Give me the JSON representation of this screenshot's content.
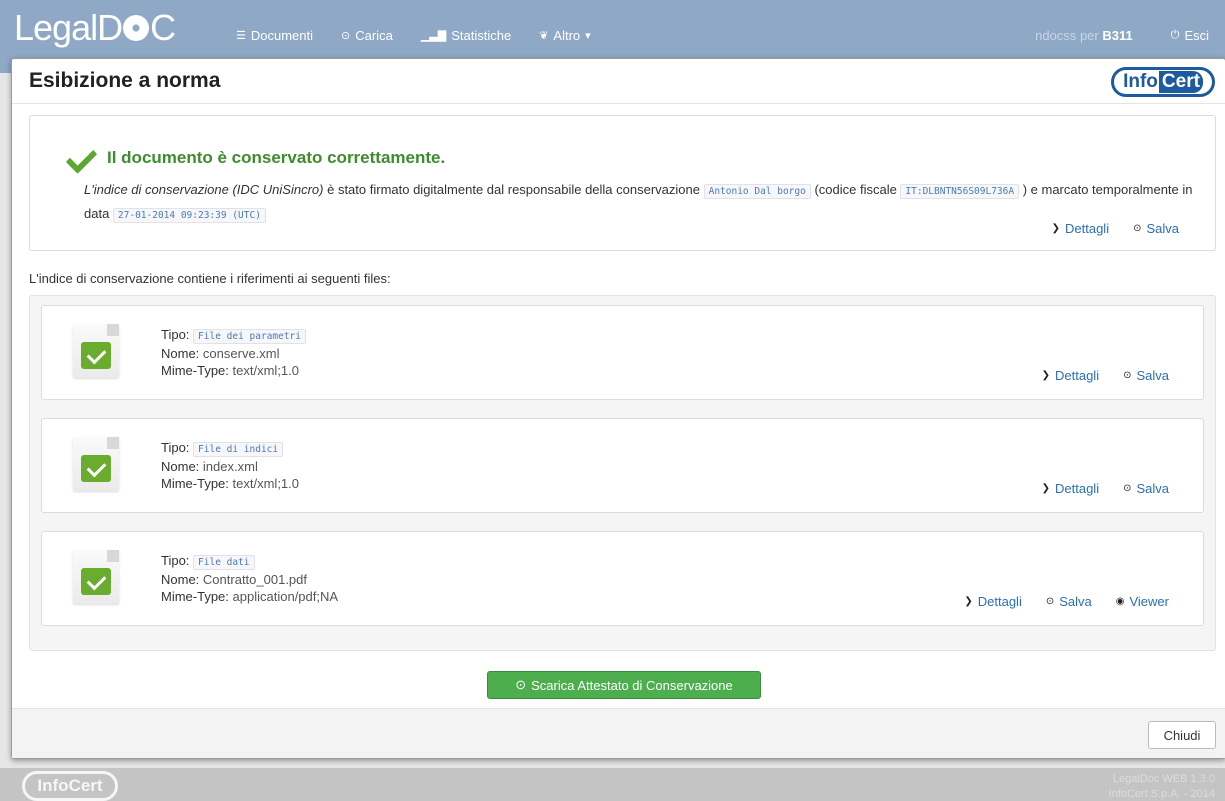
{
  "nav": {
    "logo": "LegalDoc",
    "logo_prefix": "LegalD",
    "logo_suffix": "C",
    "items": [
      {
        "label": "Documenti",
        "icon": "list-icon"
      },
      {
        "label": "Carica",
        "icon": "upload-icon"
      },
      {
        "label": "Statistiche",
        "icon": "bar-chart-icon"
      },
      {
        "label": "Altro",
        "icon": "leaf-icon"
      }
    ],
    "user_name": "ndocss",
    "user_per": "per",
    "user_code": "B311",
    "logout": "Esci"
  },
  "modal": {
    "title": "Esibizione a norma",
    "brand": "InfoCert",
    "brand_a": "Info",
    "brand_b": "Cert",
    "status": {
      "heading": "Il documento è conservato correttamente.",
      "text_1_italic": "L'indice di conservazione (IDC UniSincro)",
      "text_2": " è stato firmato digitalmente dal responsabile della conservazione ",
      "responsible": "Antonio Dal borgo",
      "text_3": " (codice fiscale ",
      "fiscal_code": "IT:DLBNTN56S09L736A",
      "text_4": " ) e marcato temporalmente in data ",
      "timestamp": "27-01-2014 09:23:39 (UTC)",
      "details": "Dettagli",
      "save": "Salva"
    },
    "files_intro": "L'indice di conservazione contiene i riferimenti ai seguenti files:",
    "labels": {
      "tipo": "Tipo:",
      "nome": "Nome:",
      "mime": "Mime-Type:"
    },
    "files": [
      {
        "tipo": "File dei parametri",
        "nome": "conserve.xml",
        "mime": "text/xml;1.0",
        "details": "Dettagli",
        "save": "Salva",
        "viewer": ""
      },
      {
        "tipo": "File di indici",
        "nome": "index.xml",
        "mime": "text/xml;1.0",
        "details": "Dettagli",
        "save": "Salva",
        "viewer": ""
      },
      {
        "tipo": "File dati",
        "nome": "Contratto_001.pdf",
        "mime": "application/pdf;NA",
        "details": "Dettagli",
        "save": "Salva",
        "viewer": "Viewer"
      }
    ],
    "download_button": "Scarica Attestato di Conservazione",
    "close_button": "Chiudi"
  },
  "footer": {
    "brand": "InfoCert",
    "version": "LegalDoc WEB 1.3.0",
    "company": "InfoCert S.p.A. - 2014"
  },
  "colors": {
    "navbar": "#8ea8c6",
    "success": "#3d8c2e",
    "link": "#2a6fb5",
    "button_green": "#4cae4c",
    "brand_blue": "#1d5a9e"
  }
}
